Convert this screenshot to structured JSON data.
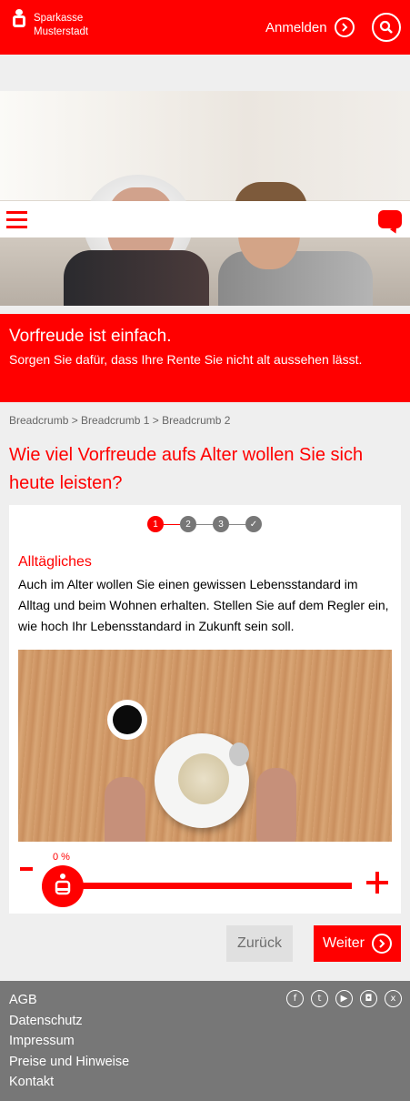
{
  "header": {
    "brand_line1": "Sparkasse",
    "brand_line2": "Musterstadt",
    "login_label": "Anmelden",
    "accent_color": "#ff0000"
  },
  "hero": {
    "title": "Vorfreude ist einfach.",
    "subtitle": "Sorgen Sie dafür, dass Ihre Rente Sie nicht alt aussehen lässt."
  },
  "breadcrumb": "Breadcrumb > Breadcrumb 1 > Breadcrumb 2",
  "question": "Wie viel Vorfreude aufs Alter wollen Sie sich heute leisten?",
  "wizard": {
    "steps": [
      {
        "label": "1",
        "state": "active"
      },
      {
        "label": "2",
        "state": "pending"
      },
      {
        "label": "3",
        "state": "pending"
      },
      {
        "label": "✓",
        "state": "pending"
      }
    ],
    "section_title": "Alltägliches",
    "description": "Auch im Alter wollen Sie einen gewissen Lebensstandard im Alltag und beim Wohnen erhalten. Stellen Sie auf dem Regler ein, wie hoch Ihr Lebensstandard in Zukunft sein soll.",
    "slider_value": "0 %",
    "minus_label": "-",
    "plus_label": "+"
  },
  "buttons": {
    "back_label": "Zurück",
    "next_label": "Weiter"
  },
  "footer": {
    "links": [
      "AGB",
      "Datenschutz",
      "Impressum",
      "Preise und Hinweise",
      "Kontakt"
    ],
    "social_icons": [
      "facebook-icon",
      "twitter-icon",
      "youtube-icon",
      "instagram-icon",
      "xing-icon"
    ]
  }
}
